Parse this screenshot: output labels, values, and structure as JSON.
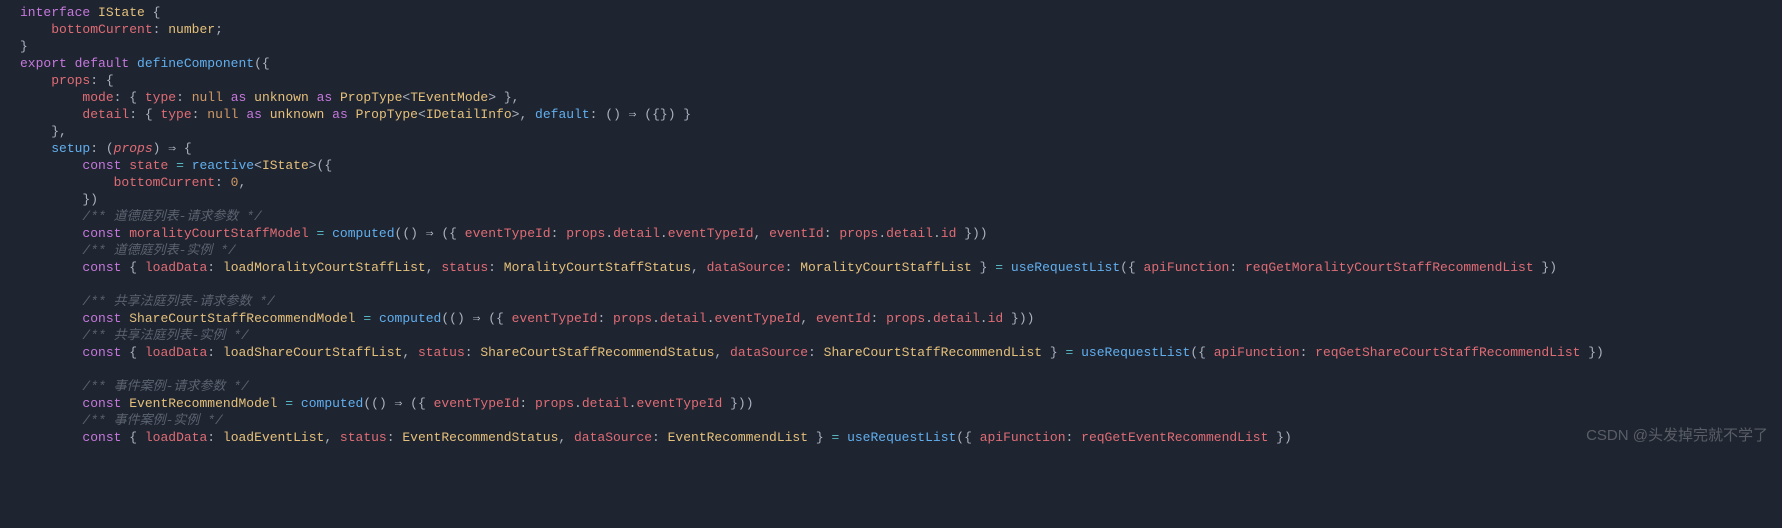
{
  "code": {
    "l1_interface": "interface",
    "l1_name": "IState",
    "l1_brace": "{",
    "l2_prop": "bottomCurrent",
    "l2_type": "number",
    "l3_brace": "}",
    "l4_export": "export",
    "l4_default": "default",
    "l4_fn": "defineComponent",
    "l4_paren": "({",
    "l5_props": "props",
    "l5_brace": ": {",
    "l6_mode": "mode",
    "l6_type_kw": "type",
    "l6_null": "null",
    "l6_as": "as",
    "l6_unknown": "unknown",
    "l6_PropType": "PropType",
    "l6_TEventMode": "TEventMode",
    "l7_detail": "detail",
    "l7_default": "default",
    "l7_arrow": "() ⇒ ({}) }",
    "l8_brace": "},",
    "l9_setup": "setup",
    "l9_props_param": "props",
    "l9_arrow": ") ⇒ {",
    "l10_const": "const",
    "l10_state": "state",
    "l10_reactive": "reactive",
    "l10_IState": "IState",
    "l11_bottomCurrent": "bottomCurrent",
    "l11_zero": "0",
    "l12_brace": "})",
    "l13_comment": "/** 道德庭列表-请求参数 */",
    "l14_const": "const",
    "l14_m1": "moralityCourtStaffModel",
    "l14_computed": "computed",
    "l14_eventTypeId": "eventTypeId",
    "l14_props": "props",
    "l14_detail": "detail",
    "l14_eventId": "eventId",
    "l14_id": "id",
    "l15_comment": "/** 道德庭列表-实例 */",
    "l16_const": "const",
    "l16_loadData": "loadData",
    "l16_load1": "loadMoralityCourtStaffList",
    "l16_status": "status",
    "l16_s1": "MoralityCourtStaffStatus",
    "l16_dataSource": "dataSource",
    "l16_ds1": "MoralityCourtStaffList",
    "l16_useReq": "useRequestList",
    "l16_apiFn": "apiFunction",
    "l16_req1": "reqGetMoralityCourtStaffRecommendList",
    "l18_comment": "/** 共享法庭列表-请求参数 */",
    "l19_const": "const",
    "l19_m2": "ShareCourtStaffRecommendModel",
    "l20_comment": "/** 共享法庭列表-实例 */",
    "l21_load2": "loadShareCourtStaffList",
    "l21_s2": "ShareCourtStaffRecommendStatus",
    "l21_ds2": "ShareCourtStaffRecommendList",
    "l21_req2": "reqGetShareCourtStaffRecommendList",
    "l23_comment": "/** 事件案例-请求参数 */",
    "l24_m3": "EventRecommendModel",
    "l25_comment": "/** 事件案例-实例 */",
    "l26_load3": "loadEventList",
    "l26_s3": "EventRecommendStatus",
    "l26_ds3": "EventRecommendList",
    "l26_req3": "reqGetEventRecommendList"
  },
  "watermark": "CSDN @头发掉完就不学了"
}
